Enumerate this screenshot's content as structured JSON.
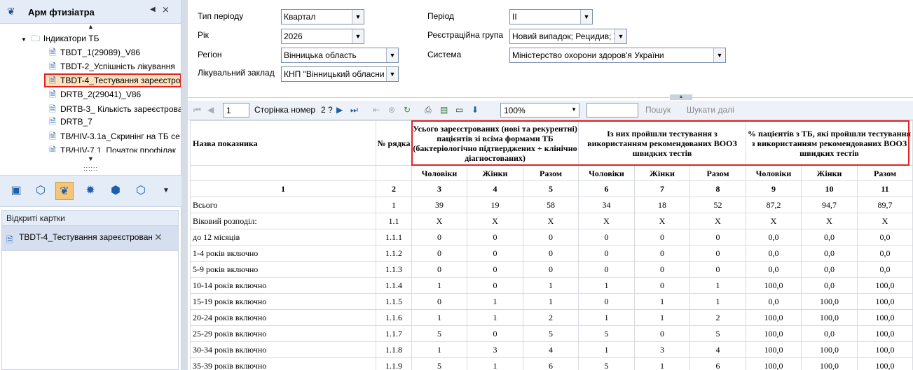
{
  "app": {
    "title": "Арм фтизіатра"
  },
  "tree": {
    "root": "Індикатори ТБ",
    "items": [
      {
        "label": "TBDT_1(29089)_V86"
      },
      {
        "label": "TBDT-2_Успішність лікування"
      },
      {
        "label": "TBDT-4_Тестування зареєстро"
      },
      {
        "label": "DRTB_2(29041)_V86"
      },
      {
        "label": "DRTB-3_ Кількість зареєстрова"
      },
      {
        "label": "DRTB_7"
      },
      {
        "label": "TB/HIV-3.1a_Скринінг на ТБ се"
      },
      {
        "label": "TB/HIV-7.1_Початок профілак"
      }
    ]
  },
  "opened": {
    "header": "Відкриті картки",
    "card": "TBDT-4_Тестування зареєстрован"
  },
  "params": {
    "period_type": {
      "label": "Тип періоду",
      "value": "Квартал"
    },
    "year": {
      "label": "Рік",
      "value": "2026"
    },
    "region": {
      "label": "Регіон",
      "value": "Вінницька область"
    },
    "facility": {
      "label": "Лікувальний заклад",
      "value": "КНП \"Вінницький обласни"
    },
    "period": {
      "label": "Період",
      "value": "ІІ"
    },
    "reg_group": {
      "label": "Реєстраційна група",
      "value": "Новий випадок; Рецидив; У"
    },
    "system": {
      "label": "Система",
      "value": "Міністерство охорони здоров'я України"
    }
  },
  "toolbar": {
    "page_value": "1",
    "page_label": "Сторінка номер",
    "page_of": "2 ?",
    "zoom": "100%",
    "search_value": "",
    "search_btn": "Пошук",
    "search_next": "Шукати далі"
  },
  "table": {
    "h_name": "Назва показника",
    "h_row": "№ рядка",
    "h_g1": "Усього зареєстрованих (нові та рекурентні) пацієнтів зі всіма формами ТБ (бактеріологічно підтверджених + клінічно діагностованих)",
    "h_g2": "Із них пройшли тестування з використанням рекомендованих ВООЗ швидких тестів",
    "h_g3": "% пацієнтів з ТБ, які пройшли тестування з використанням рекомендованих ВООЗ швидких тестів",
    "sub": [
      "Чоловіки",
      "Жінки",
      "Разом",
      "Чоловіки",
      "Жінки",
      "Разом",
      "Чоловіки",
      "Жінки",
      "Разом"
    ],
    "nums": [
      "1",
      "2",
      "3",
      "4",
      "5",
      "6",
      "7",
      "8",
      "9",
      "10",
      "11"
    ],
    "rows": [
      {
        "name": "Всього",
        "no": "1",
        "v": [
          "39",
          "19",
          "58",
          "34",
          "18",
          "52",
          "87,2",
          "94,7",
          "89,7"
        ]
      },
      {
        "name": "Віковий розподіл:",
        "no": "1.1",
        "v": [
          "X",
          "X",
          "X",
          "X",
          "X",
          "X",
          "X",
          "X",
          "X"
        ]
      },
      {
        "name": "до 12 місяців",
        "no": "1.1.1",
        "v": [
          "0",
          "0",
          "0",
          "0",
          "0",
          "0",
          "0,0",
          "0,0",
          "0,0"
        ]
      },
      {
        "name": "1-4 років включно",
        "no": "1.1.2",
        "v": [
          "0",
          "0",
          "0",
          "0",
          "0",
          "0",
          "0,0",
          "0,0",
          "0,0"
        ]
      },
      {
        "name": "5-9 років включно",
        "no": "1.1.3",
        "v": [
          "0",
          "0",
          "0",
          "0",
          "0",
          "0",
          "0,0",
          "0,0",
          "0,0"
        ]
      },
      {
        "name": "10-14 років включно",
        "no": "1.1.4",
        "v": [
          "1",
          "0",
          "1",
          "1",
          "0",
          "1",
          "100,0",
          "0,0",
          "100,0"
        ]
      },
      {
        "name": "15-19 років включно",
        "no": "1.1.5",
        "v": [
          "0",
          "1",
          "1",
          "0",
          "1",
          "1",
          "0,0",
          "100,0",
          "100,0"
        ]
      },
      {
        "name": "20-24 років включно",
        "no": "1.1.6",
        "v": [
          "1",
          "1",
          "2",
          "1",
          "1",
          "2",
          "100,0",
          "100,0",
          "100,0"
        ]
      },
      {
        "name": "25-29 років включно",
        "no": "1.1.7",
        "v": [
          "5",
          "0",
          "5",
          "5",
          "0",
          "5",
          "100,0",
          "0,0",
          "100,0"
        ]
      },
      {
        "name": "30-34 років включно",
        "no": "1.1.8",
        "v": [
          "1",
          "3",
          "4",
          "1",
          "3",
          "4",
          "100,0",
          "100,0",
          "100,0"
        ]
      },
      {
        "name": "35-39 років включно",
        "no": "1.1.9",
        "v": [
          "5",
          "1",
          "6",
          "5",
          "1",
          "6",
          "100,0",
          "100,0",
          "100,0"
        ]
      }
    ]
  }
}
